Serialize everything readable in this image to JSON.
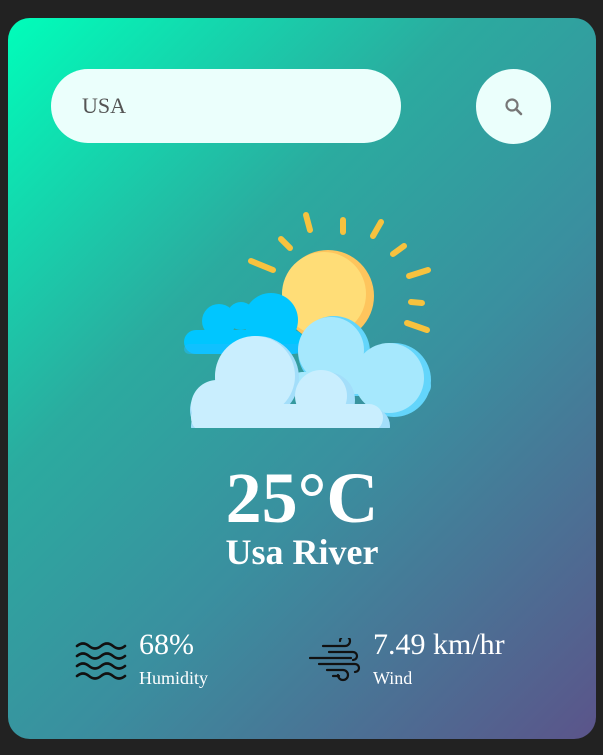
{
  "search": {
    "value": "USA",
    "icon": "search-icon"
  },
  "weather": {
    "icon": "sun-behind-clouds-icon",
    "temperature": "25°C",
    "city": "Usa River"
  },
  "details": {
    "humidity": {
      "icon": "humidity-waves-icon",
      "value": "68%",
      "label": "Humidity"
    },
    "wind": {
      "icon": "wind-icon",
      "value": "7.49 km/hr",
      "label": "Wind"
    }
  },
  "colors": {
    "page_background": "#222222",
    "gradient_start": "#00feba",
    "gradient_end": "#5b548a",
    "field_background": "#ebfffc",
    "text": "#ffffff"
  }
}
